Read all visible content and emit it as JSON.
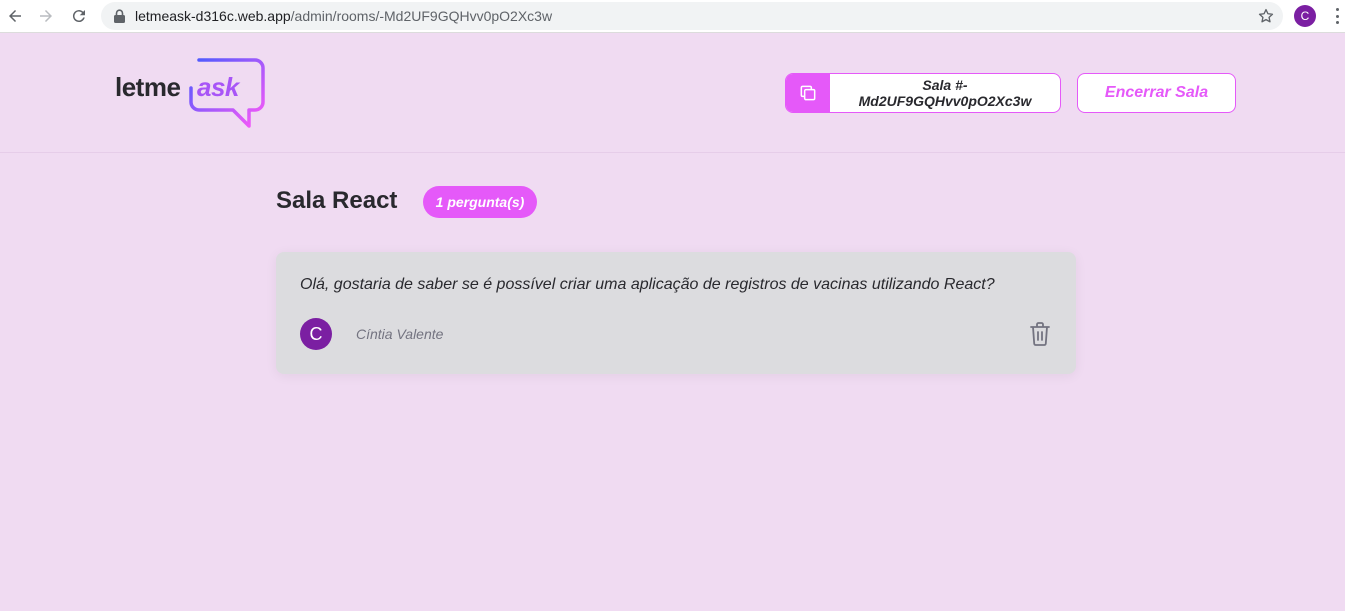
{
  "browser": {
    "url_domain": "letmeask-d316c.web.app",
    "url_path": "/admin/rooms/-Md2UF9GQHvv0pO2Xc3w",
    "profile_initial": "C"
  },
  "header": {
    "logo_left": "letme",
    "logo_right": "ask",
    "room_code_label": "Sala #-Md2UF9GQHvv0pO2Xc3w",
    "close_room_label": "Encerrar Sala"
  },
  "room": {
    "title": "Sala React",
    "question_count": "1 pergunta(s)"
  },
  "questions": [
    {
      "content": "Olá, gostaria de saber se é possível criar uma aplicação de registros de vacinas utilizando React?",
      "author_initial": "C",
      "author_name": "Cíntia Valente"
    }
  ],
  "colors": {
    "accent": "#e559f9",
    "background": "#f0dbf2",
    "card": "#dcdcdf",
    "avatar": "#7b1fa2"
  }
}
